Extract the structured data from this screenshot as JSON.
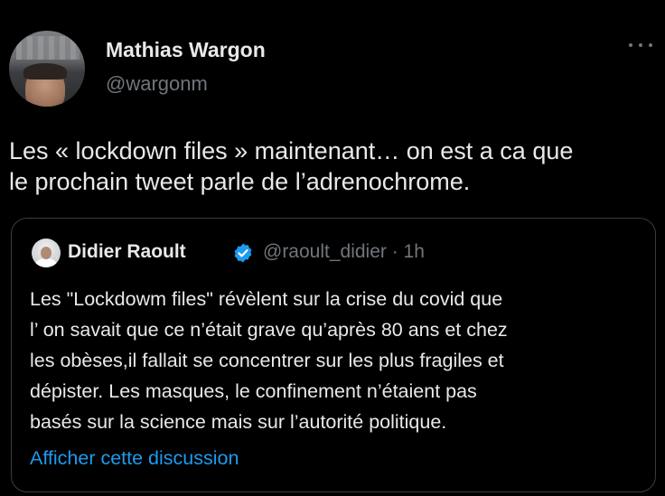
{
  "tweet": {
    "author_name": "Mathias Wargon",
    "author_handle": "@wargonm",
    "text": "Les « lockdown files » maintenant… on est a ca que\nle prochain tweet parle de l’adrenochrome.",
    "more_icon": "more-horizontal-icon"
  },
  "quoted": {
    "author_name": "Didier Raoult",
    "verified_icon": "verified-badge-icon",
    "meta": "@raoult_didier · 1h",
    "text": "Les \"Lockdowm files\" révèlent sur la crise du covid que\nl’ on savait que ce n’était grave qu’après 80 ans et chez\nles obèses,il fallait se concentrer sur les plus fragiles et\ndépister. Les masques, le confinement n’étaient pas\nbasés sur la science mais sur l’autorité politique.",
    "show_thread": "Afficher cette discussion"
  },
  "colors": {
    "background": "#000000",
    "text_primary": "#e7e9ea",
    "text_secondary": "#71767b",
    "link": "#1d9bf0",
    "verified": "#1d9bf0",
    "border": "#3a3d41"
  }
}
